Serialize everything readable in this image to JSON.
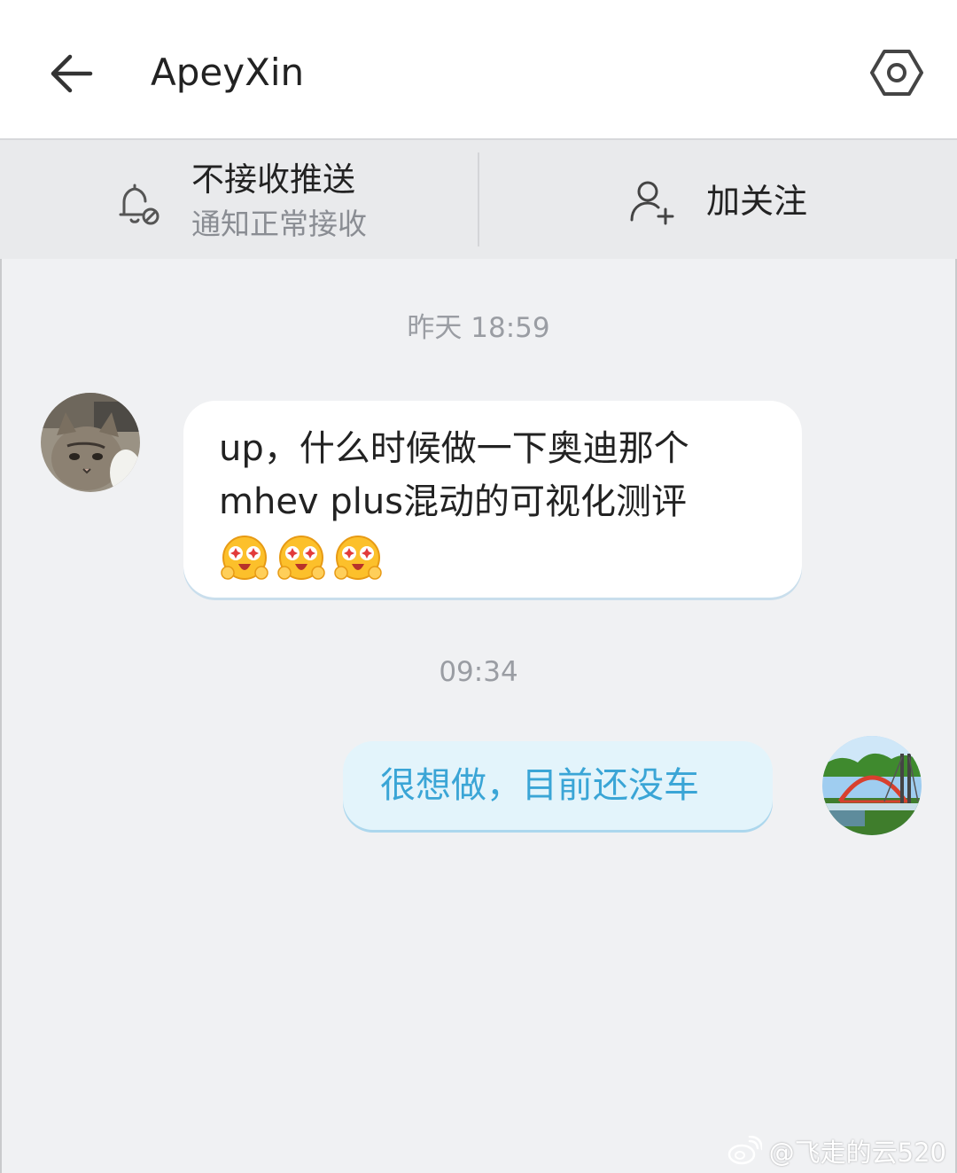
{
  "header": {
    "back_icon": "arrow-left-icon",
    "title": "ApeyXin",
    "settings_icon": "hexagon-settings-icon"
  },
  "action_bar": {
    "push": {
      "icon": "bell-muted-icon",
      "title": "不接收推送",
      "subtitle": "通知正常接收"
    },
    "follow": {
      "icon": "user-plus-icon",
      "label": "加关注"
    }
  },
  "messages": [
    {
      "timestamp": "昨天 18:59",
      "direction": "incoming",
      "avatar": "cat-avatar",
      "lines": [
        "up，什么时候做一下奥迪那个",
        "mhev plus混动的可视化测评"
      ],
      "emoji": [
        "starry-eyed-emoji",
        "starry-eyed-emoji",
        "starry-eyed-emoji"
      ]
    },
    {
      "timestamp": "09:34",
      "direction": "outgoing",
      "avatar": "bridge-avatar",
      "text": "很想做，目前还没车"
    }
  ],
  "watermark": {
    "icon": "weibo-icon",
    "text": "@飞走的云520"
  },
  "colors": {
    "background": "#f0f1f3",
    "header_bg": "#ffffff",
    "action_bar_bg": "#e9eaec",
    "incoming_bubble": "#ffffff",
    "outgoing_bubble": "#e3f4fb",
    "outgoing_text": "#3aa5d6",
    "timestamp_text": "#9a9da3"
  }
}
